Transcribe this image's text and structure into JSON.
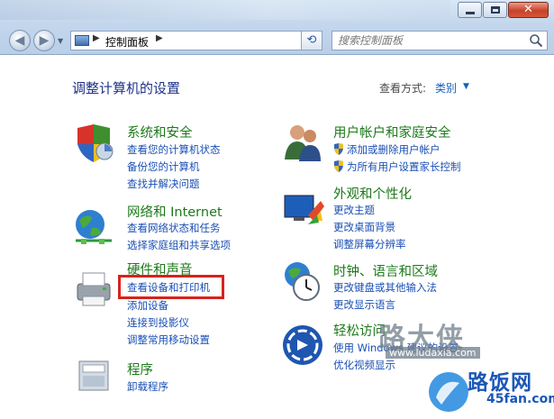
{
  "window": {
    "address_path": "控制面板",
    "search_placeholder": "搜索控制面板",
    "close_glyph": "✕"
  },
  "header": {
    "title": "调整计算机的设置",
    "view_by_label": "查看方式:",
    "view_by_value": "类别"
  },
  "categories": [
    {
      "title": "系统和安全",
      "icon": "shield-security-icon",
      "links": [
        "查看您的计算机状态",
        "备份您的计算机",
        "查找并解决问题"
      ]
    },
    {
      "title": "网络和 Internet",
      "icon": "network-globe-icon",
      "links": [
        "查看网络状态和任务",
        "选择家庭组和共享选项"
      ]
    },
    {
      "title": "硬件和声音",
      "icon": "printer-icon",
      "links": [
        "查看设备和打印机",
        "添加设备",
        "连接到投影仪",
        "调整常用移动设置"
      ]
    },
    {
      "title": "程序",
      "icon": "programs-icon",
      "links": [
        "卸载程序"
      ]
    },
    {
      "title": "用户帐户和家庭安全",
      "icon": "users-icon",
      "links": [
        "添加或删除用户帐户",
        "为所有用户设置家长控制"
      ]
    },
    {
      "title": "外观和个性化",
      "icon": "monitor-paint-icon",
      "links": [
        "更改主题",
        "更改桌面背景",
        "调整屏幕分辨率"
      ]
    },
    {
      "title": "时钟、语言和区域",
      "icon": "clock-globe-icon",
      "links": [
        "更改键盘或其他输入法",
        "更改显示语言"
      ]
    },
    {
      "title": "轻松访问",
      "icon": "ease-of-access-icon",
      "links": [
        "使用 Windows 建议的设置",
        "优化视频显示"
      ]
    }
  ],
  "watermarks": {
    "ludaxia": "路大侠",
    "ludaxia_url": "www.ludaxia.com",
    "lufan": "路饭网",
    "lufan_url": "45fan.com"
  },
  "colors": {
    "category_title": "#1d7a1a",
    "link": "#1a4fb4",
    "page_title": "#1e3287",
    "highlight_box": "#d8221c"
  }
}
